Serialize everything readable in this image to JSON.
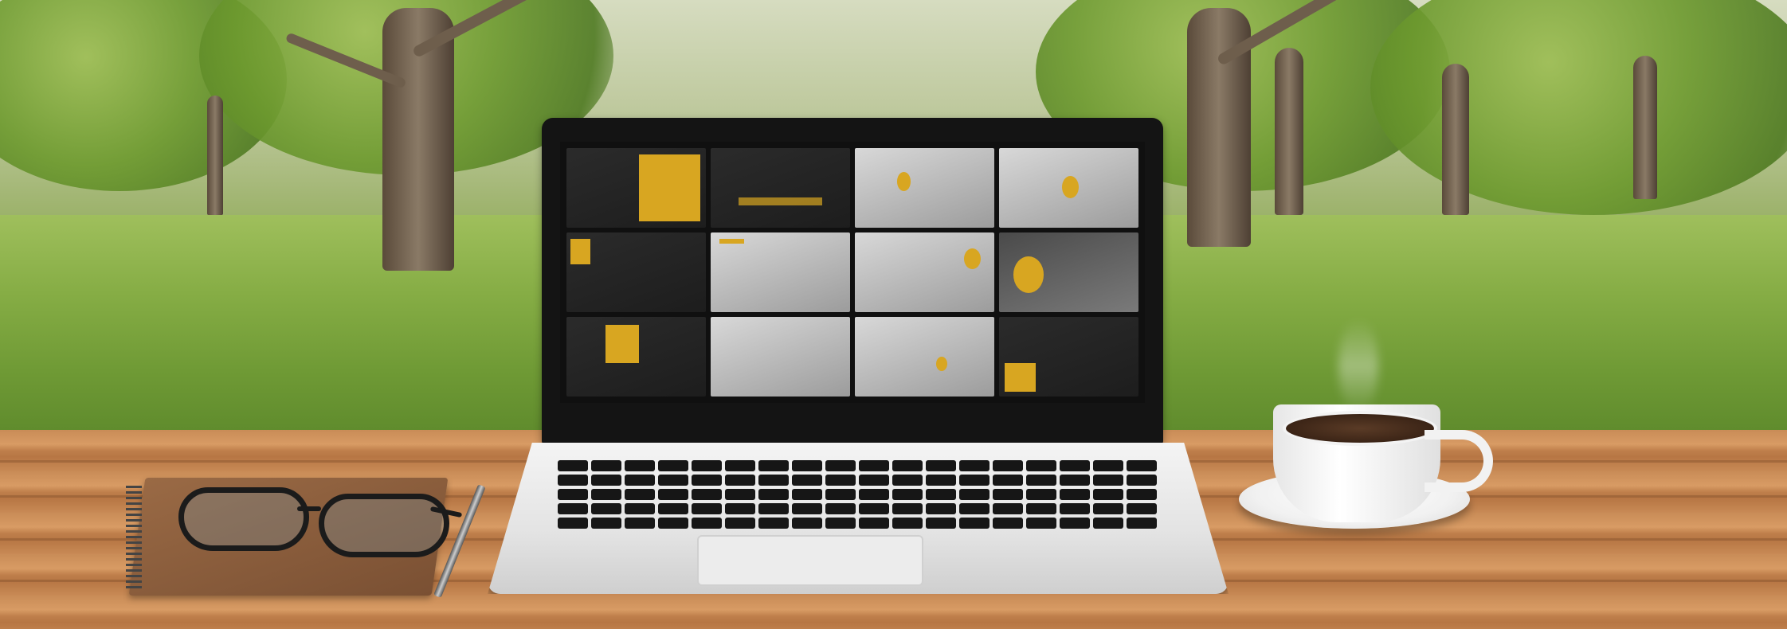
{
  "scene": {
    "colors": {
      "grass": "#7fa147",
      "table_wood": "#c98c57",
      "laptop_bezel": "#141414",
      "laptop_body": "#e8e8e8",
      "slide_accent": "#d8a621",
      "coffee": "#3b2416"
    },
    "objects": [
      "laptop",
      "glasses",
      "notebook",
      "pencil",
      "coffee-cup",
      "saucer"
    ],
    "screen": {
      "slide_count": 12,
      "slide_styles": [
        "dark",
        "dark",
        "light",
        "light",
        "dark",
        "light",
        "light",
        "mid",
        "dark",
        "light",
        "light",
        "dark"
      ]
    }
  }
}
